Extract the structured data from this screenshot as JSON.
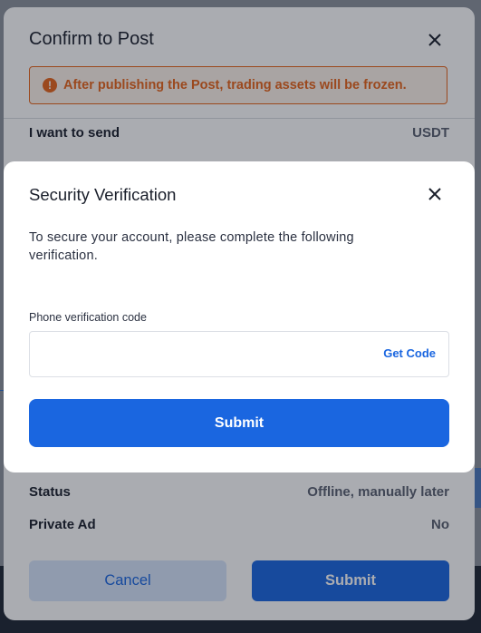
{
  "confirm_dialog": {
    "title": "Confirm to Post",
    "warning": "After publishing the Post, trading assets will be frozen.",
    "rows": [
      {
        "label": "I want to send",
        "value": "USDT"
      },
      {
        "label": "Status",
        "value": "Offline, manually later"
      },
      {
        "label": "Private Ad",
        "value": "No"
      }
    ],
    "cancel_label": "Cancel",
    "submit_label": "Submit"
  },
  "security_dialog": {
    "title": "Security Verification",
    "description": "To secure your account, please complete the following verification.",
    "phone_label": "Phone verification code",
    "code_value": "",
    "get_code_label": "Get Code",
    "submit_label": "Submit"
  },
  "icons": {
    "close": "close-icon",
    "warning": "warning-icon"
  },
  "colors": {
    "primary": "#1a66e0",
    "warning": "#e8641a"
  }
}
